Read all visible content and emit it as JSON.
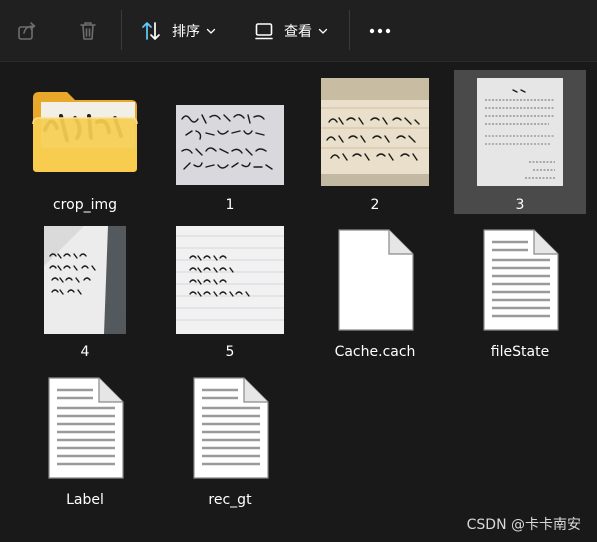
{
  "toolbar": {
    "share_icon": "share-icon",
    "delete_icon": "trash-icon",
    "sort_label": "排序",
    "view_label": "查看",
    "more_icon": "more-dots-icon"
  },
  "files": [
    {
      "name": "crop_img",
      "kind": "folder"
    },
    {
      "name": "1",
      "kind": "image"
    },
    {
      "name": "2",
      "kind": "image"
    },
    {
      "name": "3",
      "kind": "image",
      "selected": true
    },
    {
      "name": "4",
      "kind": "image"
    },
    {
      "name": "5",
      "kind": "image"
    },
    {
      "name": "Cache.cach",
      "kind": "blank-file"
    },
    {
      "name": "fileState",
      "kind": "text-file"
    },
    {
      "name": "Label",
      "kind": "text-file"
    },
    {
      "name": "rec_gt",
      "kind": "text-file"
    }
  ],
  "watermark": "CSDN @卡卡南安",
  "colors": {
    "background": "#191919",
    "toolbar": "#202020",
    "selected": "#4a4a4a",
    "accent": "#60cdff",
    "folder": "#f3c33c"
  }
}
